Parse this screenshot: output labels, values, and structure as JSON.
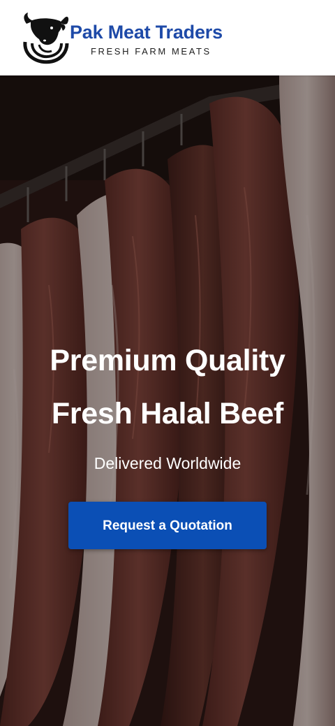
{
  "header": {
    "brand_name": "Pak Meat Traders",
    "tagline": "FRESH FARM MEATS",
    "logo_icon": "bull-head-icon",
    "brand_color": "#1e4aa8"
  },
  "hero": {
    "background": "hanging-beef-carcasses-photo",
    "title_line1": "Premium Quality",
    "title_line2": "Fresh Halal Beef",
    "subtitle": "Delivered Worldwide",
    "cta_label": "Request a Quotation",
    "cta_color": "#0b4fb5"
  }
}
